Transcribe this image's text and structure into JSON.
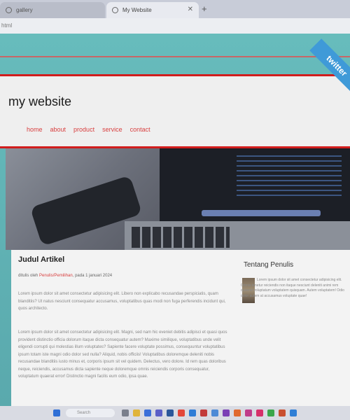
{
  "browser": {
    "tabs": [
      {
        "label": "gallery"
      },
      {
        "label": "My Website"
      }
    ],
    "address_text": "html",
    "new_tab_label": "+"
  },
  "site": {
    "title": "my website",
    "nav": [
      "home",
      "about",
      "product",
      "service",
      "contact"
    ],
    "ribbon_text": "twitter"
  },
  "article": {
    "title": "Judul Artikel",
    "meta_prefix": "ditulis oleh",
    "author": "Penulis/Pemilihan",
    "meta_suffix": ", pada 1 januari 2024",
    "p1": "Lorem ipsum dolor sit amet consectetur adipisicing elit. Libero non explicabo recusandae perspiciatis, quam blanditiis? Ut natus nesciunt consequatur accusamus, voluptatibus quas modi non fuga perferendis incidunt qui, quos architecto.",
    "p2": "Lorem ipsum dolor sit amet consectetur adipisicing elit. Magni, sed nam hic eveniet debitis adipisci et quasi quos provident distinctio officia dolorum itaque dicta consequatur autem? Maxime similique, voluptatibus unde velit eligendi corrupti qui molestias illum voluptates? Sapiente facere voluptate possimus, consequuntur voluptatibus ipsum totam iste magni odio dolor sed nulla? Aliquid, nobis officiis! Voluptatibus doloremque deleniti nobis recusandae blanditiis iusto minus et, corporis ipsum sit vel quidem. Delectus, vero dolore. Id rem quas doloribus neque, reiciendis, accusamus dicta sapiente neque doloremque omnis reiciendis corporis consequatur, voluptatum quaerat error! Distinctio magni facilis eum odio, ipsa quae."
  },
  "sidebar": {
    "title": "Tentang Penulis",
    "text": "Lorem ipsum dolor sit amet consectetur adipisicing elit. Omnis tenetur reiciendis non itaque nesciunt deleniti animi rem quaerat voluptatum voluptatem quisquam. Autem voluptatem! Odio dolor autem at accusamus voluptate quae!"
  },
  "taskbar": {
    "search_label": "Search"
  }
}
